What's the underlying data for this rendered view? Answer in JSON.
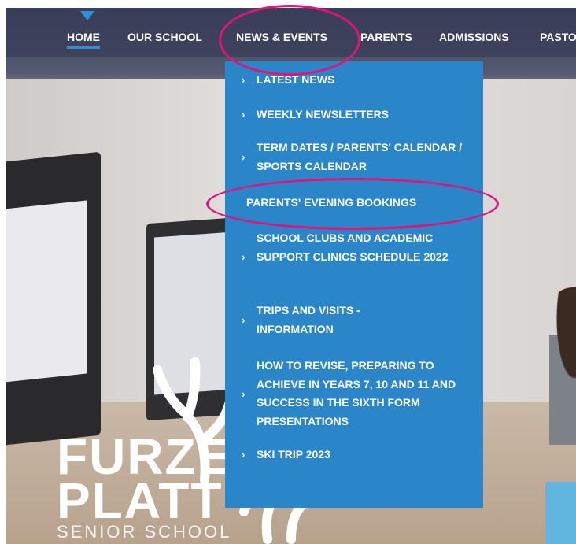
{
  "nav": {
    "items": [
      {
        "label": "HOME",
        "active": true
      },
      {
        "label": "OUR SCHOOL"
      },
      {
        "label": "NEWS & EVENTS"
      },
      {
        "label": "PARENTS"
      },
      {
        "label": "ADMISSIONS"
      },
      {
        "label": "PASTO"
      }
    ]
  },
  "dropdown": {
    "items": [
      {
        "label": "LATEST NEWS"
      },
      {
        "label": "WEEKLY NEWSLETTERS"
      },
      {
        "label": "TERM DATES / PARENTS' CALENDAR / SPORTS CALENDAR"
      },
      {
        "label": "PARENTS' EVENING BOOKINGS"
      },
      {
        "label": "SCHOOL CLUBS AND ACADEMIC SUPPORT CLINICS SCHEDULE 2022"
      },
      {
        "label": "TRIPS AND VISITS - INFORMATION"
      },
      {
        "label": "HOW TO REVISE, PREPARING TO ACHIEVE IN YEARS 7, 10 AND 11 AND SUCCESS IN THE SIXTH FORM PRESENTATIONS"
      },
      {
        "label": "SKI TRIP 2023"
      }
    ],
    "chevron": "›"
  },
  "logo": {
    "line1": "FURZE",
    "line2": "PLATT",
    "line3": "SENIOR SCHOOL"
  },
  "colors": {
    "nav_accent": "#2f8fd6",
    "dropdown_bg": "#2b86c9",
    "annotation": "#e0147a"
  }
}
